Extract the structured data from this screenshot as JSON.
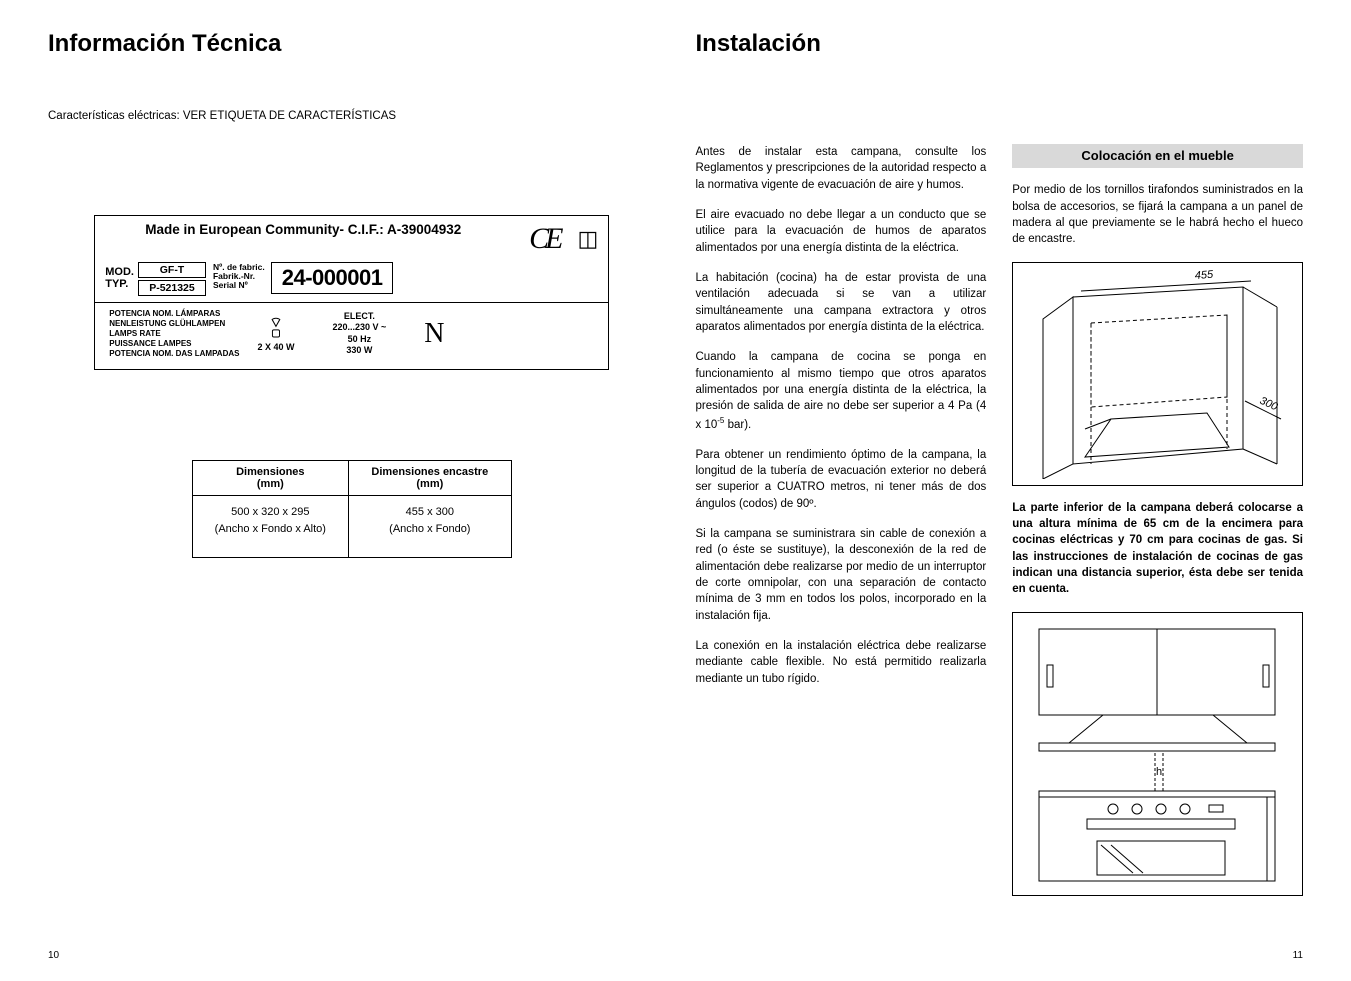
{
  "left": {
    "title": "Información Técnica",
    "elecSpec": "Características eléctricas: VER ETIQUETA DE CARACTERÍSTICAS",
    "plate": {
      "madeIn": "Made in European Community- C.I.F.: A-39004932",
      "mod": "MOD.",
      "typ": "TYP.",
      "gft": "GF-T",
      "pnum": "P-521325",
      "fabrik1": "Nº. de fabric.",
      "fabrik2": "Fabrik.-Nr.",
      "fabrik3": "Serial Nº",
      "serial": "24-000001",
      "ce": "CE",
      "sq": "◫",
      "lampsLines": [
        "POTENCIA NOM. LÁMPARAS",
        "NENLEISTUNG GLÜHLAMPEN",
        "LAMPS RATE",
        "PUISSANCE LAMPES",
        "POTENCIA NOM. DAS LAMPADAS"
      ],
      "bulbGlyph": "💡",
      "bulbPower": "2 X 40 W",
      "electLines": [
        "ELECT.",
        "220...230 V ~",
        "50 Hz",
        "330 W"
      ],
      "nsym": "N"
    },
    "table": {
      "h1a": "Dimensiones",
      "h1b": "(mm)",
      "h2a": "Dimensiones encastre",
      "h2b": "(mm)",
      "c1a": "500 x 320 x 295",
      "c1b": "(Ancho x Fondo x Alto)",
      "c2a": "455 x 300",
      "c2b": "(Ancho x Fondo)"
    },
    "pageNum": "10"
  },
  "right": {
    "title": "Instalación",
    "col1": {
      "p1": "Antes de instalar esta campana, consulte los Reglamentos y prescripciones de la autoridad respecto a la normativa vigente de evacuación de aire y humos.",
      "p2": "El aire evacuado no debe llegar a un conducto que se utilice para la evacuación de humos de aparatos alimentados por una energía distinta de la eléctrica.",
      "p3": "La habitación (cocina) ha de estar provista de una ventilación adecuada si se van a utilizar simultáneamente una campana extractora y otros aparatos alimentados por energía distinta de la eléctrica.",
      "p4a": "Cuando la campana de cocina se ponga en funcionamiento al mismo tiempo que otros aparatos alimentados por una energía distinta de la eléctrica, la presión de salida de aire no debe ser superior a 4 Pa (4 x 10",
      "p4sup": "-5",
      "p4b": " bar).",
      "p5": "Para obtener un rendimiento óptimo de la campana, la longitud de la tubería de evacuación exterior no deberá ser superior a CUATRO metros, ni tener más de dos ángulos (codos) de 90º.",
      "p6": "Si la campana se suministrara sin cable de conexión a red (o éste se sustituye), la desconexión de la red de alimentación debe realizarse por medio de un interruptor de corte omnipolar, con una separación de contacto mínima de 3 mm en todos los polos, incorporado en la instalación fija.",
      "p7": "La conexión en la instalación eléctrica debe realizarse mediante cable flexible. No está permitido realizarla mediante un tubo rígido."
    },
    "col2": {
      "sectionTitle": "Colocación en el mueble",
      "p1": "Por medio de los tornillos tirafondos suministrados en la bolsa de accesorios, se fijará la campana a un panel de madera al que previamente se le habrá hecho el hueco de encastre.",
      "dim455": "455",
      "dim300": "300",
      "boldNote": "La parte inferior de la campana deberá colocarse a una altura mínima de 65 cm de la encimera para cocinas eléctricas y 70 cm para cocinas de gas. Si las instrucciones de instalación de cocinas de gas indican una distancia superior, ésta debe ser tenida en cuenta.",
      "hLabel": "h"
    },
    "pageNum": "11"
  }
}
